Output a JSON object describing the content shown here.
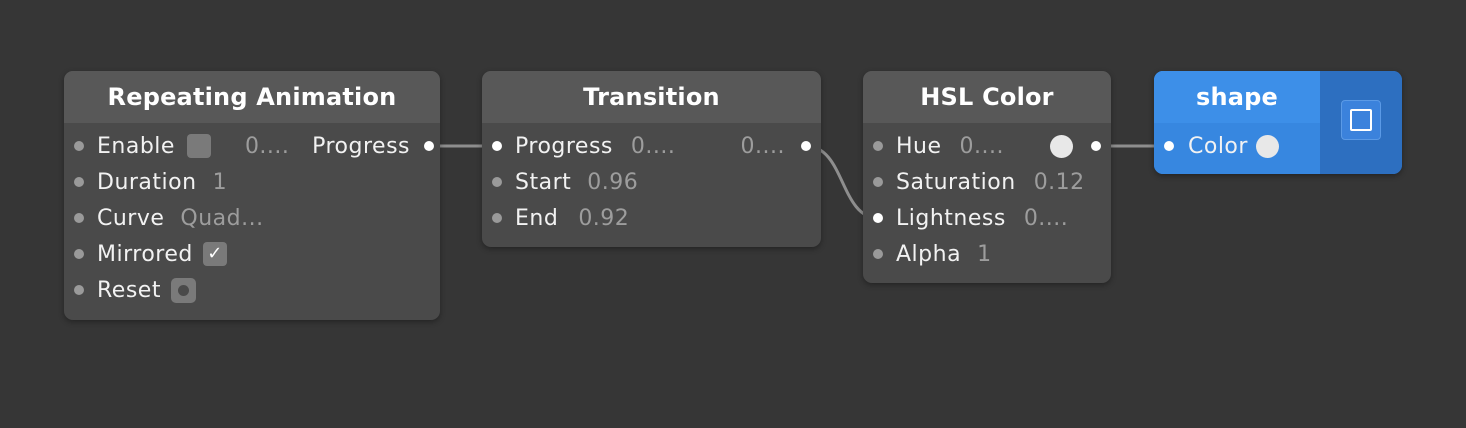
{
  "nodes": {
    "repeating_animation": {
      "title": "Repeating Animation",
      "inputs": [
        {
          "label": "Enable",
          "value": "0...."
        },
        {
          "label": "Duration",
          "value": "1"
        },
        {
          "label": "Curve",
          "value": "Quad..."
        },
        {
          "label": "Mirrored",
          "checked": true,
          "check_glyph": "✓"
        },
        {
          "label": "Reset"
        }
      ],
      "output": {
        "label": "Progress"
      }
    },
    "transition": {
      "title": "Transition",
      "inputs": [
        {
          "label": "Progress",
          "value": "0...."
        },
        {
          "label": "Start",
          "value": "0.96"
        },
        {
          "label": "End",
          "value": "0.92"
        }
      ],
      "output": {
        "value": "0...."
      }
    },
    "hsl_color": {
      "title": "HSL Color",
      "inputs": [
        {
          "label": "Hue",
          "value": "0...."
        },
        {
          "label": "Saturation",
          "value": "0.12"
        },
        {
          "label": "Lightness",
          "value": "0...."
        },
        {
          "label": "Alpha",
          "value": "1"
        }
      ],
      "output": {
        "swatch_color": "#e8e8e8"
      }
    },
    "shape": {
      "title": "shape",
      "inputs": [
        {
          "label": "Color",
          "swatch_color": "#e8e8e8"
        }
      ],
      "icon": "square-outline-icon"
    }
  },
  "colors": {
    "canvas": "#363636",
    "node_body": "#4a4a4a",
    "node_header": "#585858",
    "accent_blue": "#3787e0",
    "wire": "#8e8e8e"
  }
}
